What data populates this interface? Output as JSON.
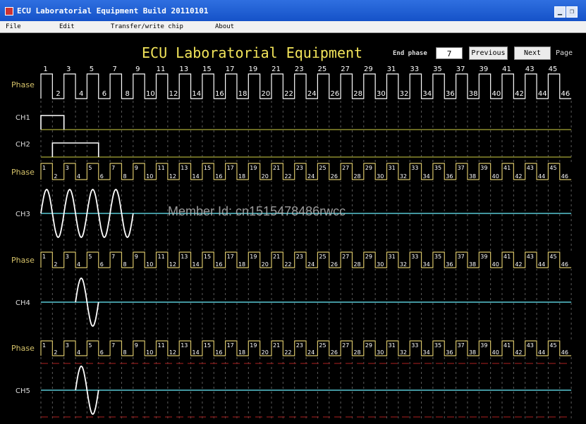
{
  "window": {
    "title": "ECU Laboratorial Equipment Build 20110101"
  },
  "menu": [
    "File",
    "Edit",
    "Transfer/write chip",
    "About"
  ],
  "header": {
    "title": "ECU Laboratorial Equipment",
    "end_phase_label": "End phase",
    "end_phase_value": "7",
    "previous_label": "Previous",
    "next_label": "Next",
    "page_label": "Page"
  },
  "phase_label": "Phase",
  "phase_count": 46,
  "channels": [
    {
      "label": "CH1",
      "signal": "pulse",
      "high_from_phase": 1,
      "high_to_phase": 3,
      "color": "#ffffff"
    },
    {
      "label": "CH2",
      "signal": "pulse",
      "high_from_phase": 2,
      "high_to_phase": 6,
      "color": "#ffffff"
    },
    {
      "label": "CH3",
      "signal": "sine",
      "from_phase": 1,
      "to_phase": 9,
      "cycles": 4,
      "color": "#ffffff"
    },
    {
      "label": "CH4",
      "signal": "sine",
      "from_phase": 4,
      "to_phase": 6,
      "cycles": 1,
      "color": "#ffffff"
    },
    {
      "label": "CH5",
      "signal": "sine",
      "from_phase": 4,
      "to_phase": 6,
      "cycles": 1,
      "color": "#ffffff"
    }
  ],
  "colors": {
    "phase_wave": "#d6c36a",
    "phase_label": "#d6c36a",
    "channel_label": "#dddddd",
    "baseline_cyan": "#58c8d4",
    "baseline_olive": "#8c8c2e",
    "grid": "#5a5a5a",
    "red_dashes": "#8b1a1a",
    "title": "#f2e45a"
  },
  "watermark": "Member Id: cn1515478486rwcc"
}
